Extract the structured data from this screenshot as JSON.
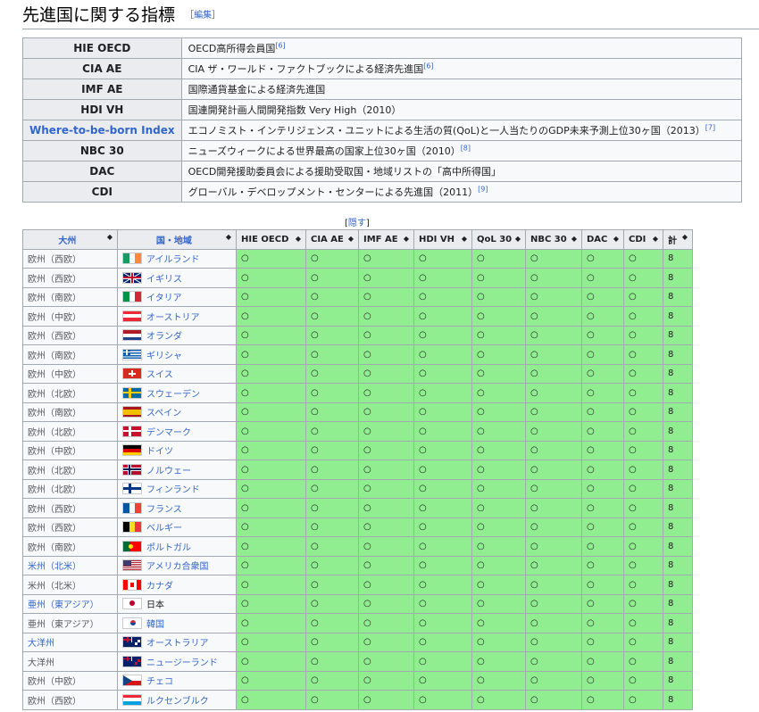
{
  "heading": {
    "title": "先進国に関する指標",
    "edit_open": "［",
    "edit_label": "編集",
    "edit_close": "］"
  },
  "definitions": [
    {
      "key": "HIE OECD",
      "text": "OECD高所得会員国",
      "ref": "[6]",
      "link": false
    },
    {
      "key": "CIA AE",
      "text": "CIA ザ・ワールド・ファクトブックによる経済先進国",
      "ref": "[6]",
      "link": false
    },
    {
      "key": "IMF AE",
      "text": "国際通貨基金による経済先進国",
      "ref": "",
      "link": false
    },
    {
      "key": "HDI VH",
      "text": "国連開発計画人間開発指数 Very High（2010）",
      "ref": "",
      "link": false
    },
    {
      "key": "Where-to-be-born Index",
      "text": "エコノミスト・インテリジェンス・ユニットによる生活の質(QoL)と一人当たりのGDP未来予測上位30ヶ国（2013）",
      "ref": "[7]",
      "link": true
    },
    {
      "key": "NBC 30",
      "text": "ニューズウィークによる世界最高の国家上位30ヶ国（2010）",
      "ref": "[8]",
      "link": false
    },
    {
      "key": "DAC",
      "text": "OECD開発援助委員会による援助受取国・地域リストの「高中所得国」",
      "ref": "",
      "link": false
    },
    {
      "key": "CDI",
      "text": "グローバル・デベロップメント・センターによる先進国（2011）",
      "ref": "[9]",
      "link": false
    }
  ],
  "toggle": {
    "open": "[",
    "label": "隠す",
    "close": "]"
  },
  "columns": [
    "大州",
    "国・地域",
    "HIE OECD",
    "CIA AE",
    "IMF AE",
    "HDI VH",
    "QoL 30",
    "NBC 30",
    "DAC",
    "CDI",
    "計"
  ],
  "sort_icon": "sort-icon",
  "mark": "○",
  "colors": {
    "green": "#90ee90",
    "link": "#3366cc",
    "header_bg": "#eaecf0"
  },
  "rows": [
    {
      "region": "欧州（西欧）",
      "country": "アイルランド",
      "flag": "ireland",
      "total": "8"
    },
    {
      "region": "欧州（西欧）",
      "country": "イギリス",
      "flag": "uk",
      "total": "8"
    },
    {
      "region": "欧州（南欧）",
      "country": "イタリア",
      "flag": "italy",
      "total": "8"
    },
    {
      "region": "欧州（中欧）",
      "country": "オーストリア",
      "flag": "austria",
      "total": "8"
    },
    {
      "region": "欧州（西欧）",
      "country": "オランダ",
      "flag": "netherlands",
      "total": "8"
    },
    {
      "region": "欧州（南欧）",
      "country": "ギリシャ",
      "flag": "greece",
      "total": "8"
    },
    {
      "region": "欧州（中欧）",
      "country": "スイス",
      "flag": "switzerland",
      "total": "8"
    },
    {
      "region": "欧州（北欧）",
      "country": "スウェーデン",
      "flag": "sweden",
      "total": "8"
    },
    {
      "region": "欧州（南欧）",
      "country": "スペイン",
      "flag": "spain",
      "total": "8"
    },
    {
      "region": "欧州（北欧）",
      "country": "デンマーク",
      "flag": "denmark",
      "total": "8"
    },
    {
      "region": "欧州（中欧）",
      "country": "ドイツ",
      "flag": "germany",
      "total": "8"
    },
    {
      "region": "欧州（北欧）",
      "country": "ノルウェー",
      "flag": "norway",
      "total": "8"
    },
    {
      "region": "欧州（北欧）",
      "country": "フィンランド",
      "flag": "finland",
      "total": "8"
    },
    {
      "region": "欧州（西欧）",
      "country": "フランス",
      "flag": "france",
      "total": "8"
    },
    {
      "region": "欧州（西欧）",
      "country": "ベルギー",
      "flag": "belgium",
      "total": "8"
    },
    {
      "region": "欧州（南欧）",
      "country": "ポルトガル",
      "flag": "portugal",
      "total": "8"
    },
    {
      "region": "米州（北米）",
      "country": "アメリカ合衆国",
      "flag": "usa",
      "total": "8"
    },
    {
      "region": "米州（北米）",
      "country": "カナダ",
      "flag": "canada",
      "total": "8"
    },
    {
      "region": "亜州（東アジア）",
      "country": "日本",
      "flag": "japan",
      "total": "8"
    },
    {
      "region": "亜州（東アジア）",
      "country": "韓国",
      "flag": "korea",
      "total": "8"
    },
    {
      "region": "大洋州",
      "country": "オーストラリア",
      "flag": "australia",
      "total": "8"
    },
    {
      "region": "大洋州",
      "country": "ニュージーランド",
      "flag": "new-zealand",
      "total": "8"
    },
    {
      "region": "欧州（中欧）",
      "country": "チェコ",
      "flag": "czech",
      "total": "8"
    },
    {
      "region": "欧州（西欧）",
      "country": "ルクセンブルク",
      "flag": "luxembourg",
      "total": "8"
    }
  ]
}
